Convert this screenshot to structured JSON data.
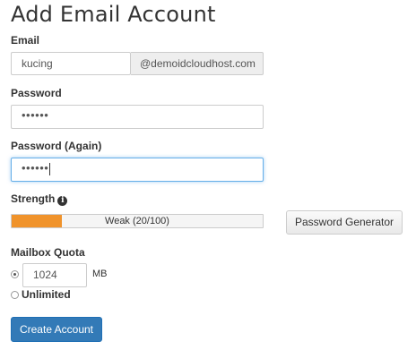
{
  "page": {
    "title": "Add Email Account"
  },
  "email": {
    "label": "Email",
    "value": "kucing",
    "domain_suffix": "@demoidcloudhost.com"
  },
  "password": {
    "label": "Password",
    "masked_value": "••••••"
  },
  "password_again": {
    "label": "Password (Again)",
    "masked_value": "••••••"
  },
  "strength": {
    "label": "Strength",
    "info_icon": "info-circle-icon",
    "meter_text": "Weak (20/100)",
    "score": 20,
    "max": 100,
    "meter_color": "#f0932b"
  },
  "password_generator": {
    "label": "Password Generator"
  },
  "mailbox_quota": {
    "label": "Mailbox Quota",
    "value": "1024",
    "unit": "MB",
    "selected": "limited",
    "unlimited_label": "Unlimited"
  },
  "create_account": {
    "label": "Create Account",
    "color": "#337ab7"
  }
}
